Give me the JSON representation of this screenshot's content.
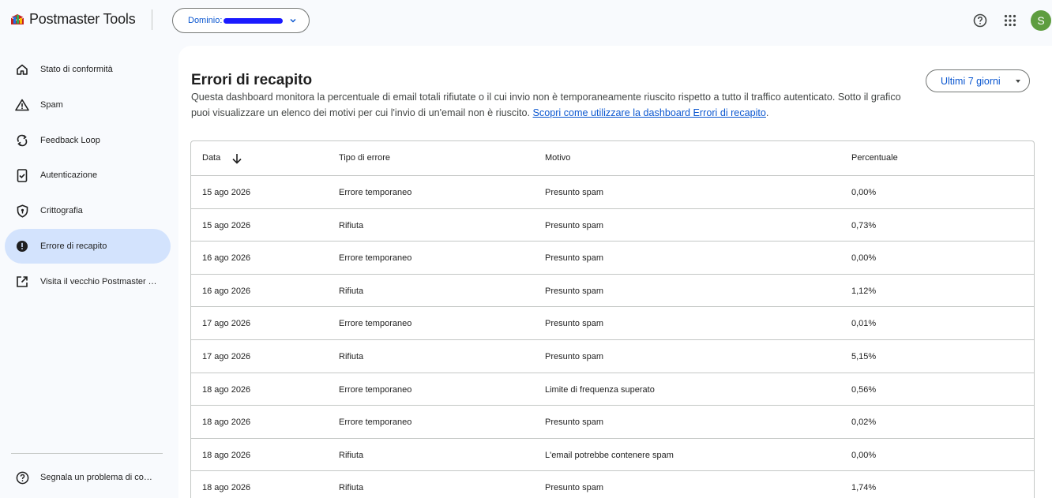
{
  "header": {
    "app_title": "Postmaster Tools",
    "domain_label": "Dominio:",
    "avatar_letter": "S"
  },
  "sidebar": {
    "items": [
      {
        "label": "Stato di conformità",
        "icon": "home-icon"
      },
      {
        "label": "Spam",
        "icon": "warning-icon"
      },
      {
        "label": "Feedback Loop",
        "icon": "sync-icon"
      },
      {
        "label": "Autenticazione",
        "icon": "verified-phone-icon"
      },
      {
        "label": "Crittografia",
        "icon": "shield-icon"
      },
      {
        "label": "Errore di recapito",
        "icon": "error-icon",
        "active": true
      },
      {
        "label": "Visita il vecchio Postmaster Tools",
        "icon": "open-in-new-icon"
      }
    ],
    "report_label": "Segnala un problema di compatibilità"
  },
  "main": {
    "title": "Errori di recapito",
    "description": "Questa dashboard monitora la percentuale di email totali rifiutate o il cui invio non è temporaneamente riuscito rispetto a tutto il traffico autenticato. Sotto il grafico puoi visualizzare un elenco dei motivi per cui l'invio di un'email non è riuscito. ",
    "learn_more_link": "Scopri come utilizzare la dashboard Errori di recapito",
    "description_end": ".",
    "period_label": "Ultimi 7 giorni"
  },
  "table": {
    "columns": [
      "Data",
      "Tipo di errore",
      "Motivo",
      "Percentuale"
    ],
    "rows": [
      [
        "15 ago 2026",
        "Errore temporaneo",
        "Presunto spam",
        "0,00%"
      ],
      [
        "15 ago 2026",
        "Rifiuta",
        "Presunto spam",
        "0,73%"
      ],
      [
        "16 ago 2026",
        "Errore temporaneo",
        "Presunto spam",
        "0,00%"
      ],
      [
        "16 ago 2026",
        "Rifiuta",
        "Presunto spam",
        "1,12%"
      ],
      [
        "17 ago 2026",
        "Errore temporaneo",
        "Presunto spam",
        "0,01%"
      ],
      [
        "17 ago 2026",
        "Rifiuta",
        "Presunto spam",
        "5,15%"
      ],
      [
        "18 ago 2026",
        "Errore temporaneo",
        "Limite di frequenza superato",
        "0,56%"
      ],
      [
        "18 ago 2026",
        "Errore temporaneo",
        "Presunto spam",
        "0,02%"
      ],
      [
        "18 ago 2026",
        "Rifiuta",
        "L'email potrebbe contenere spam",
        "0,00%"
      ],
      [
        "18 ago 2026",
        "Rifiuta",
        "Presunto spam",
        "1,74%"
      ]
    ]
  },
  "colors": {
    "accent": "#0b57d0",
    "active_nav": "#d3e3fd",
    "avatar": "#5e9d3f"
  }
}
